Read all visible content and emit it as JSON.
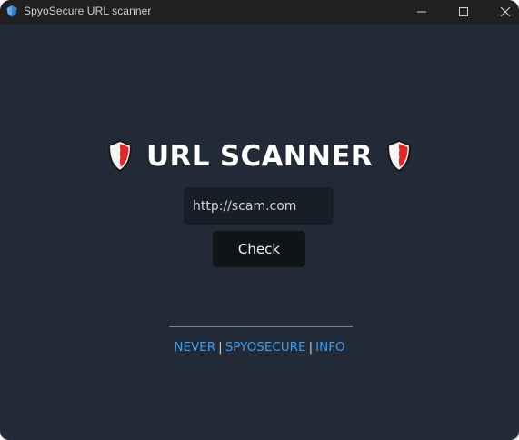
{
  "window": {
    "title": "SpyoSecure URL scanner",
    "controls": [
      "minimize-icon",
      "maximize-icon",
      "close-icon"
    ]
  },
  "main": {
    "heading": "URL SCANNER",
    "heading_icon": "shield-icon",
    "url_input": {
      "placeholder": "http://scam.com",
      "value": ""
    },
    "check_label": "Check"
  },
  "footer": {
    "links": [
      "NEVER",
      "SPYOSECURE",
      "INFO"
    ],
    "separator": "|"
  },
  "colors": {
    "background": "#212a36",
    "titlebar": "#202020",
    "input_bg": "#181e26",
    "button_bg": "#101418",
    "link": "#3f9bf0",
    "shield_red": "#e0272e"
  }
}
